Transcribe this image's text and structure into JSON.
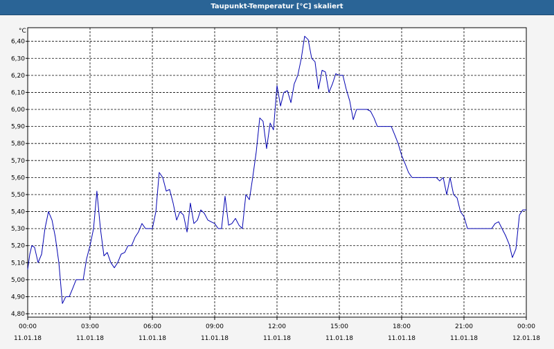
{
  "window": {
    "title": "Taupunkt-Temperatur [°C] skaliert"
  },
  "chart_data": {
    "type": "line",
    "title": "Taupunkt-Temperatur [°C] skaliert",
    "ylabel": "°C",
    "xlabel": "",
    "ylim": [
      4.78,
      6.48
    ],
    "xlim_hours": [
      0,
      24
    ],
    "grid": true,
    "line_color": "#0000b0",
    "grid_color": "#000000",
    "y_ticks": [
      "4,80",
      "4,90",
      "5,00",
      "5,10",
      "5,20",
      "5,30",
      "5,40",
      "5,50",
      "5,60",
      "5,70",
      "5,80",
      "5,90",
      "6,00",
      "6,10",
      "6,20",
      "6,30",
      "6,40"
    ],
    "y_tick_values": [
      4.8,
      4.9,
      5.0,
      5.1,
      5.2,
      5.3,
      5.4,
      5.5,
      5.6,
      5.7,
      5.8,
      5.9,
      6.0,
      6.1,
      6.2,
      6.3,
      6.4
    ],
    "x_ticks": [
      {
        "time": "00:00",
        "date": "11.01.18"
      },
      {
        "time": "03:00",
        "date": "11.01.18"
      },
      {
        "time": "06:00",
        "date": "11.01.18"
      },
      {
        "time": "09:00",
        "date": "11.01.18"
      },
      {
        "time": "12:00",
        "date": "11.01.18"
      },
      {
        "time": "15:00",
        "date": "11.01.18"
      },
      {
        "time": "18:00",
        "date": "11.01.18"
      },
      {
        "time": "21:00",
        "date": "11.01.18"
      },
      {
        "time": "00:00",
        "date": "12.01.18"
      }
    ],
    "x_tick_hours": [
      0,
      3,
      6,
      9,
      12,
      15,
      18,
      21,
      24
    ],
    "series": [
      {
        "x_hours": [
          0.0,
          0.1,
          0.2,
          0.33,
          0.5,
          0.67,
          0.83,
          1.0,
          1.17,
          1.33,
          1.5,
          1.67,
          1.83,
          2.0,
          2.17,
          2.33,
          2.5,
          2.67,
          2.83,
          3.0,
          3.17,
          3.33,
          3.5,
          3.67,
          3.83,
          4.0,
          4.17,
          4.33,
          4.5,
          4.67,
          4.83,
          5.0,
          5.17,
          5.33,
          5.5,
          5.67,
          5.83,
          6.0,
          6.17,
          6.33,
          6.5,
          6.67,
          6.83,
          7.0,
          7.17,
          7.33,
          7.5,
          7.67,
          7.83,
          8.0,
          8.17,
          8.33,
          8.5,
          8.67,
          8.83,
          9.0,
          9.17,
          9.33,
          9.5,
          9.67,
          9.83,
          10.0,
          10.17,
          10.33,
          10.5,
          10.67,
          10.83,
          11.0,
          11.17,
          11.33,
          11.5,
          11.67,
          11.83,
          12.0,
          12.17,
          12.33,
          12.5,
          12.67,
          12.83,
          13.0,
          13.17,
          13.33,
          13.5,
          13.67,
          13.83,
          14.0,
          14.17,
          14.33,
          14.5,
          14.67,
          14.83,
          15.0,
          15.17,
          15.33,
          15.5,
          15.67,
          15.83,
          16.0,
          16.17,
          16.33,
          16.5,
          16.67,
          16.83,
          17.0,
          17.17,
          17.33,
          17.5,
          17.67,
          17.83,
          18.0,
          18.17,
          18.33,
          18.5,
          18.67,
          18.83,
          19.0,
          19.17,
          19.33,
          19.5,
          19.67,
          19.83,
          20.0,
          20.17,
          20.33,
          20.5,
          20.67,
          20.83,
          21.0,
          21.17,
          21.33,
          21.5,
          21.67,
          21.83,
          22.0,
          22.17,
          22.33,
          22.5,
          22.67,
          22.83,
          23.0,
          23.17,
          23.33,
          23.5,
          23.67,
          23.83,
          24.0
        ],
        "values": [
          5.06,
          5.15,
          5.2,
          5.19,
          5.1,
          5.15,
          5.3,
          5.4,
          5.35,
          5.25,
          5.1,
          4.86,
          4.9,
          4.9,
          4.95,
          5.0,
          5.0,
          5.0,
          5.12,
          5.2,
          5.3,
          5.52,
          5.3,
          5.14,
          5.16,
          5.1,
          5.07,
          5.1,
          5.15,
          5.16,
          5.2,
          5.2,
          5.25,
          5.28,
          5.33,
          5.3,
          5.3,
          5.3,
          5.4,
          5.63,
          5.6,
          5.52,
          5.53,
          5.45,
          5.35,
          5.4,
          5.38,
          5.28,
          5.45,
          5.33,
          5.35,
          5.41,
          5.39,
          5.35,
          5.34,
          5.33,
          5.3,
          5.3,
          5.49,
          5.32,
          5.33,
          5.36,
          5.32,
          5.3,
          5.5,
          5.47,
          5.6,
          5.75,
          5.95,
          5.93,
          5.77,
          5.92,
          5.88,
          6.14,
          6.02,
          6.1,
          6.11,
          6.04,
          6.15,
          6.2,
          6.3,
          6.43,
          6.41,
          6.3,
          6.28,
          6.12,
          6.23,
          6.22,
          6.1,
          6.15,
          6.21,
          6.2,
          6.2,
          6.12,
          6.05,
          5.94,
          6.0,
          6.0,
          6.0,
          6.0,
          5.99,
          5.95,
          5.9,
          5.9,
          5.9,
          5.9,
          5.9,
          5.85,
          5.8,
          5.73,
          5.68,
          5.63,
          5.6,
          5.6,
          5.6,
          5.6,
          5.6,
          5.6,
          5.6,
          5.6,
          5.58,
          5.6,
          5.5,
          5.6,
          5.5,
          5.48,
          5.4,
          5.37,
          5.3,
          5.3,
          5.3,
          5.3,
          5.3,
          5.3,
          5.3,
          5.3,
          5.33,
          5.34,
          5.3,
          5.26,
          5.21,
          5.13,
          5.18,
          5.38,
          5.41,
          5.41
        ]
      }
    ]
  }
}
